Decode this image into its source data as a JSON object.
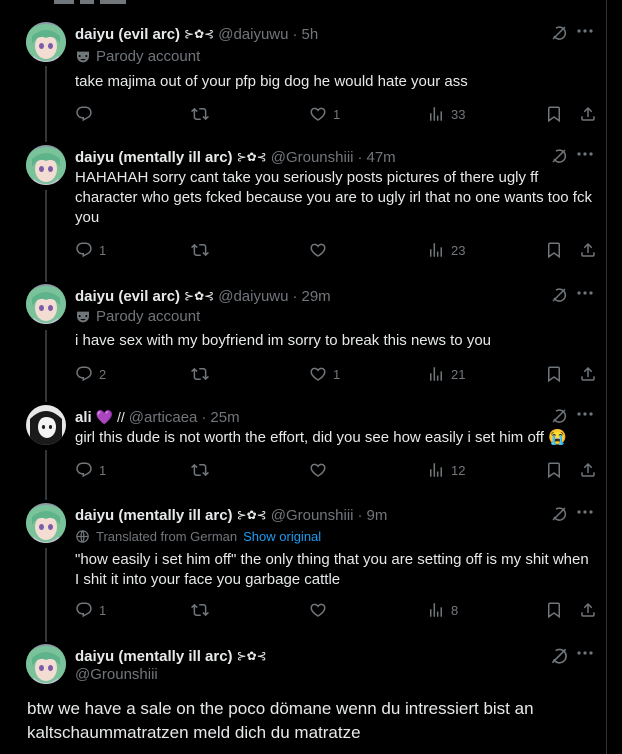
{
  "tweets": [
    {
      "name": "daiyu (evil arc)",
      "badges": "⊱✿⊰",
      "handle": "@daiyuwu",
      "time": "5h",
      "sub_label": "Parody account",
      "text": "take majima out of your pfp big dog he would hate your ass",
      "likes": "1",
      "views": "33",
      "replies": "",
      "avatar": "anime-green-hair"
    },
    {
      "name": "daiyu (mentally ill arc)",
      "badges": "⊱✿⊰",
      "handle": "@Grounshiii",
      "time": "47m",
      "text": "HAHAHAH sorry cant take you seriously posts pictures of there ugly ff character who gets fcked because you are to ugly irl that no one wants too fck you",
      "replies": "1",
      "likes": "",
      "views": "23",
      "avatar": "anime-green-hair"
    },
    {
      "name": "daiyu (evil arc)",
      "badges": "⊱✿⊰",
      "handle": "@daiyuwu",
      "time": "29m",
      "sub_label": "Parody account",
      "text": "i have sex with my boyfriend im sorry to break this news to you",
      "replies": "2",
      "likes": "1",
      "views": "21",
      "avatar": "anime-green-hair"
    },
    {
      "name": "ali",
      "badges": "💜 //",
      "handle": "@articaea",
      "time": "25m",
      "text": "girl this dude is not worth the effort, did you see how easily i set him off 😭",
      "replies": "1",
      "likes": "",
      "views": "12",
      "avatar": "monochrome-girl"
    },
    {
      "name": "daiyu (mentally ill arc)",
      "badges": "⊱✿⊰",
      "handle": "@Grounshiii",
      "time": "9m",
      "translated_label": "Translated from German",
      "show_original": "Show original",
      "text": "\"how easily i set him off\" the only thing that you are setting off is my shit when I shit it into your face you garbage cattle",
      "replies": "1",
      "likes": "",
      "views": "8",
      "avatar": "anime-green-hair"
    }
  ],
  "focused": {
    "name": "daiyu (mentally ill arc)",
    "badges": "⊱✿⊰",
    "handle": "@Grounshiii",
    "text": "btw we have a sale on the poco dömane wenn du intressiert bist an kaltschaummatratzen meld dich du matratze"
  },
  "sep": "·",
  "colors": {
    "bg": "#000000",
    "text": "#e7e9ea",
    "muted": "#71767b",
    "link": "#1d9bf0",
    "border": "#2f3336"
  }
}
